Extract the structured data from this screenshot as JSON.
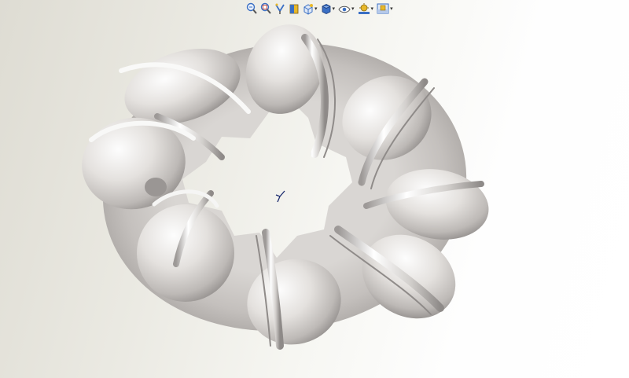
{
  "app": {
    "view": "3d-graphics-area"
  },
  "toolbar": {
    "items": [
      {
        "name": "zoom-to-fit-button",
        "icon": "zoom-to-fit-icon",
        "dropdown": false
      },
      {
        "name": "zoom-to-area-button",
        "icon": "zoom-to-area-icon",
        "dropdown": false
      },
      {
        "name": "previous-view-button",
        "icon": "previous-view-icon",
        "dropdown": false
      },
      {
        "name": "section-view-button",
        "icon": "section-view-icon",
        "dropdown": false
      },
      {
        "name": "view-orientation-button",
        "icon": "view-orientation-icon",
        "dropdown": true
      },
      {
        "name": "display-style-button",
        "icon": "display-style-icon",
        "dropdown": true
      },
      {
        "name": "hide-show-items-button",
        "icon": "hide-show-items-icon",
        "dropdown": true
      },
      {
        "name": "edit-appearance-button",
        "icon": "edit-appearance-icon",
        "dropdown": true
      },
      {
        "name": "apply-scene-button",
        "icon": "apply-scene-icon",
        "dropdown": true
      }
    ],
    "caret_glyph": "▾"
  },
  "colors": {
    "model_highlight": "#fbfbfb",
    "model_mid": "#d6d3d0",
    "model_shadow": "#8c8886",
    "background_left": "#dedcd3",
    "background_right": "#ffffff",
    "icon_blue": "#3a6fc4",
    "icon_yellow": "#e8b82a"
  }
}
